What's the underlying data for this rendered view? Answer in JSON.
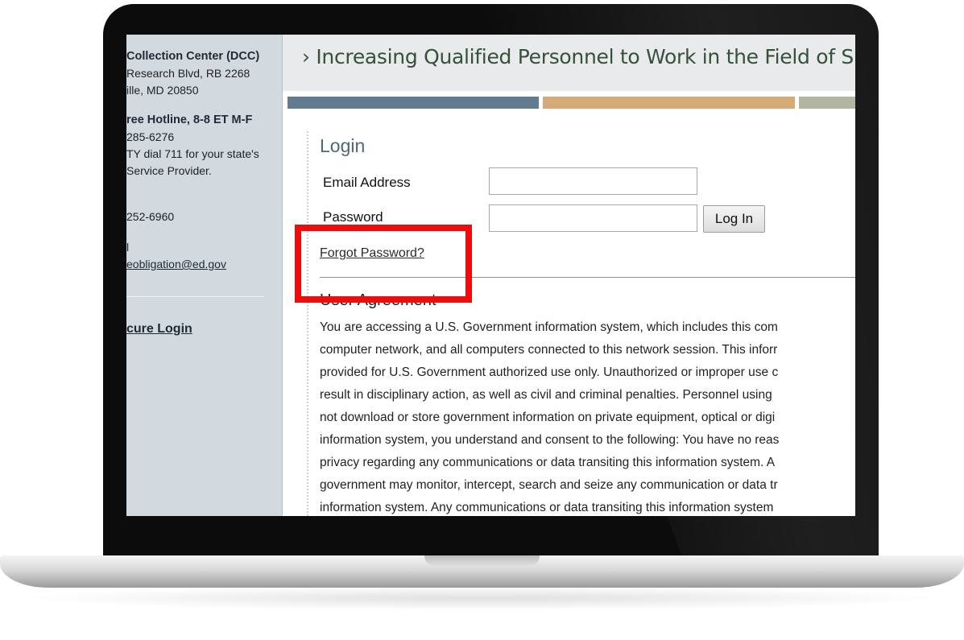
{
  "sidebar": {
    "lines": [
      {
        "text": "Collection Center (DCC)",
        "bold": true
      },
      {
        "text": "Research Blvd, RB 2268",
        "bold": false
      },
      {
        "text": "ille, MD 20850",
        "bold": false
      },
      {
        "text": "ree Hotline, 8-8 ET M-F",
        "bold": true
      },
      {
        "text": "285-6276",
        "bold": false
      },
      {
        "text": "TY dial 711 for your state's",
        "bold": false
      },
      {
        "text": "Service Provider.",
        "bold": false
      },
      {
        "text": "252-6960",
        "bold": false
      },
      {
        "text": "l",
        "bold": false
      }
    ],
    "email_link": "eobligation@ed.gov",
    "secure_login": "cure Login"
  },
  "header": {
    "title": "› Increasing Qualified Personnel to Work in the Field of Sp"
  },
  "login": {
    "title": "Login",
    "email_label": "Email Address",
    "email_value": "",
    "password_label": "Password",
    "password_value": "",
    "login_button": "Log In",
    "forgot_link": "Forgot Password?"
  },
  "agreement": {
    "title": "User Agreement",
    "lines": [
      "You are accessing a U.S. Government information system, which includes this com",
      "computer network, and all computers connected to this network session. This inforr",
      "provided for U.S. Government authorized use only. Unauthorized or improper use c",
      "result in disciplinary action, as well as civil and criminal penalties. Personnel using",
      "not download or store government information on private equipment, optical or digi",
      "information system, you understand and consent to the following: You have no reas",
      "privacy regarding any communications or data transiting this information system. A",
      "government may monitor, intercept, search and seize any communication or data tr",
      "information system. Any communications or data transiting this information system"
    ]
  },
  "colors": {
    "stripe_blue": "#637b8e",
    "stripe_tan": "#d3aa78",
    "stripe_sage": "#b0b69f",
    "highlight": "#ee0c0c",
    "header_text": "#35513c",
    "login_title": "#4d6878"
  }
}
